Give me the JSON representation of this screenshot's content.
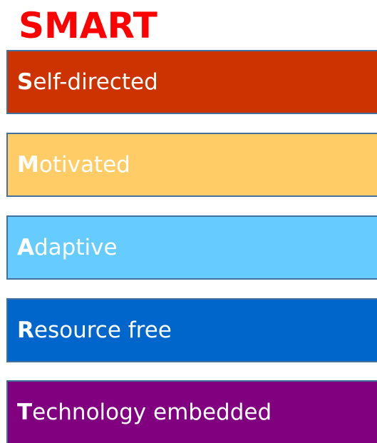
{
  "title": "SMART",
  "title_color": "#ff0000",
  "items": [
    {
      "initial": "S",
      "rest": "elf-directed",
      "fill": "#cc3300",
      "text_color": "#ffffff"
    },
    {
      "initial": "M",
      "rest": "otivated",
      "fill": "#ffcc66",
      "text_color": "#ffffff"
    },
    {
      "initial": "A",
      "rest": "daptive",
      "fill": "#66ccff",
      "text_color": "#ffffff"
    },
    {
      "initial": "R",
      "rest": "esource free",
      "fill": "#0066cc",
      "text_color": "#ffffff"
    },
    {
      "initial": "T",
      "rest": "echnology embedded",
      "fill": "#800080",
      "text_color": "#ffffff"
    }
  ]
}
